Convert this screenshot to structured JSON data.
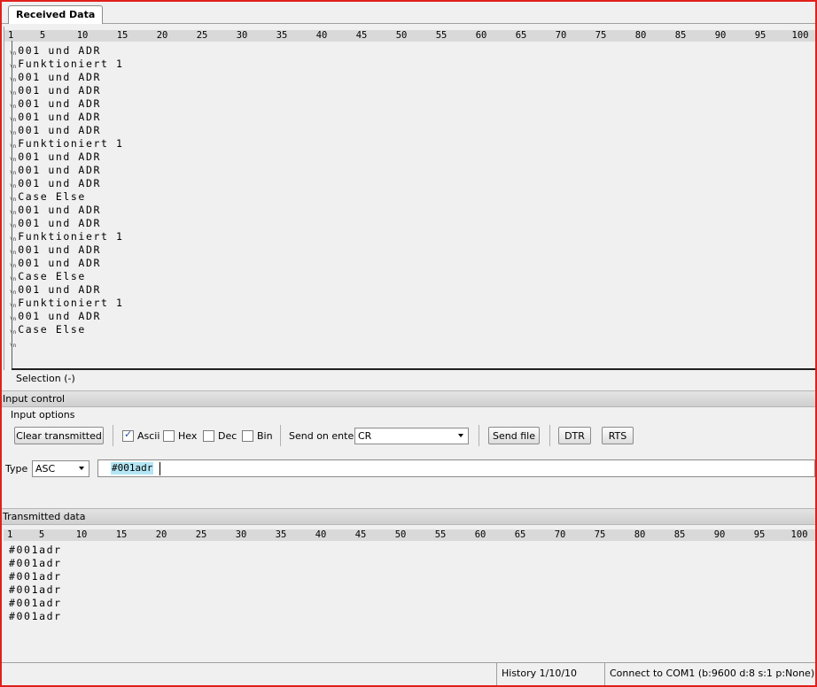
{
  "tab": {
    "label": "Received Data"
  },
  "ruler_marks": [
    "1",
    "5",
    "10",
    "15",
    "20",
    "25",
    "30",
    "35",
    "40",
    "45",
    "50",
    "55",
    "60",
    "65",
    "70",
    "75",
    "80",
    "85",
    "90",
    "95",
    "100"
  ],
  "received": {
    "newline_glyph": "\\n",
    "lines": [
      "001 und ADR",
      "Funktioniert 1",
      "001 und ADR",
      "001 und ADR",
      "001 und ADR",
      "001 und ADR",
      "001 und ADR",
      "Funktioniert 1",
      "001 und ADR",
      "001 und ADR",
      "001 und ADR",
      "Case Else",
      "001 und ADR",
      "001 und ADR",
      "Funktioniert 1",
      "001 und ADR",
      "001 und ADR",
      "Case Else",
      "001 und ADR",
      "Funktioniert 1",
      "001 und ADR",
      "Case Else",
      ""
    ],
    "selection_label": "Selection (-)"
  },
  "input_control": {
    "header": "Input control",
    "options_title": "Input options",
    "clear_button": "Clear transmitted",
    "checkboxes": [
      {
        "label": "Ascii",
        "checked": true
      },
      {
        "label": "Hex",
        "checked": false
      },
      {
        "label": "Dec",
        "checked": false
      },
      {
        "label": "Bin",
        "checked": false
      }
    ],
    "send_on_enter_label": "Send on enter",
    "send_on_enter_value": "CR",
    "send_file_button": "Send file",
    "dtr_button": "DTR",
    "rts_button": "RTS",
    "type_label": "Type",
    "type_value": "ASC",
    "input_value": "#001adr"
  },
  "transmitted": {
    "header": "Transmitted data",
    "lines": [
      "#001adr",
      "#001adr",
      "#001adr",
      "#001adr",
      "#001adr",
      "#001adr"
    ]
  },
  "status": {
    "history": "History 1/10/10",
    "connection": "Connect to COM1 (b:9600 d:8 s:1 p:None)"
  }
}
